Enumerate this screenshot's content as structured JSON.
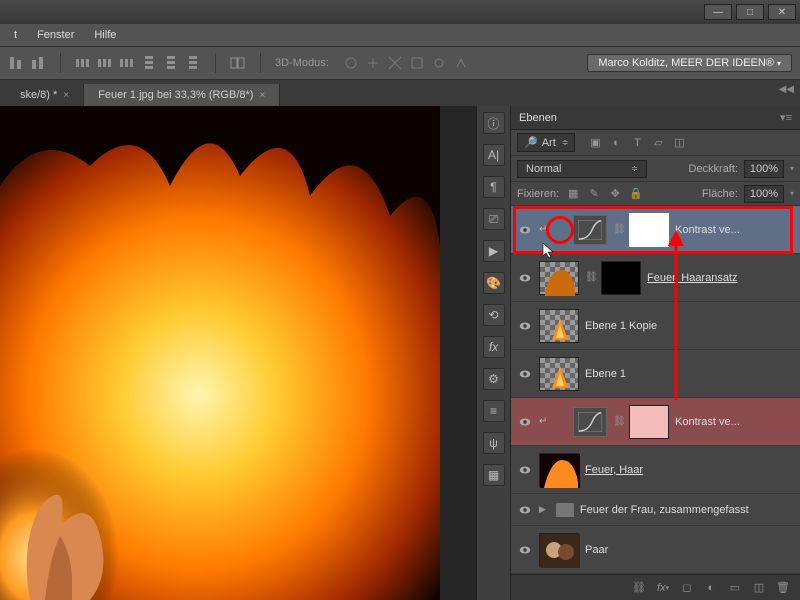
{
  "menubar": {
    "items": [
      "t",
      "Fenster",
      "Hilfe"
    ]
  },
  "optbar": {
    "mode_label": "3D-Modus:",
    "user": "Marco Kolditz, MEER DER IDEEN®"
  },
  "tabs": [
    {
      "label": "ske/8) *",
      "active": false
    },
    {
      "label": "Feuer 1.jpg bei 33,3% (RGB/8*)",
      "active": true
    }
  ],
  "panel": {
    "title": "Ebenen",
    "kind_label": "Art",
    "blend_label": "Normal",
    "opacity_label": "Deckkraft:",
    "opacity_value": "100%",
    "lock_label": "Fixieren:",
    "fill_label": "Fläche:",
    "fill_value": "100%"
  },
  "layers": [
    {
      "type": "adj",
      "name": "Kontrast ve...",
      "clip": true,
      "mask": "white",
      "selected": true
    },
    {
      "type": "img",
      "name": "Feuer, Haaransatz",
      "underline": true,
      "checker": true,
      "mask": "black"
    },
    {
      "type": "img",
      "name": "Ebene 1 Kopie",
      "checker": true
    },
    {
      "type": "img",
      "name": "Ebene 1",
      "checker": true
    },
    {
      "type": "adj",
      "name": "Kontrast ve...",
      "clip": true,
      "mask": "pink",
      "red": true
    },
    {
      "type": "img",
      "name": "Feuer, Haar",
      "underline": true,
      "checker": true
    },
    {
      "type": "group",
      "name": "Feuer der Frau, zusammengefasst"
    },
    {
      "type": "img",
      "name": "Paar"
    }
  ]
}
